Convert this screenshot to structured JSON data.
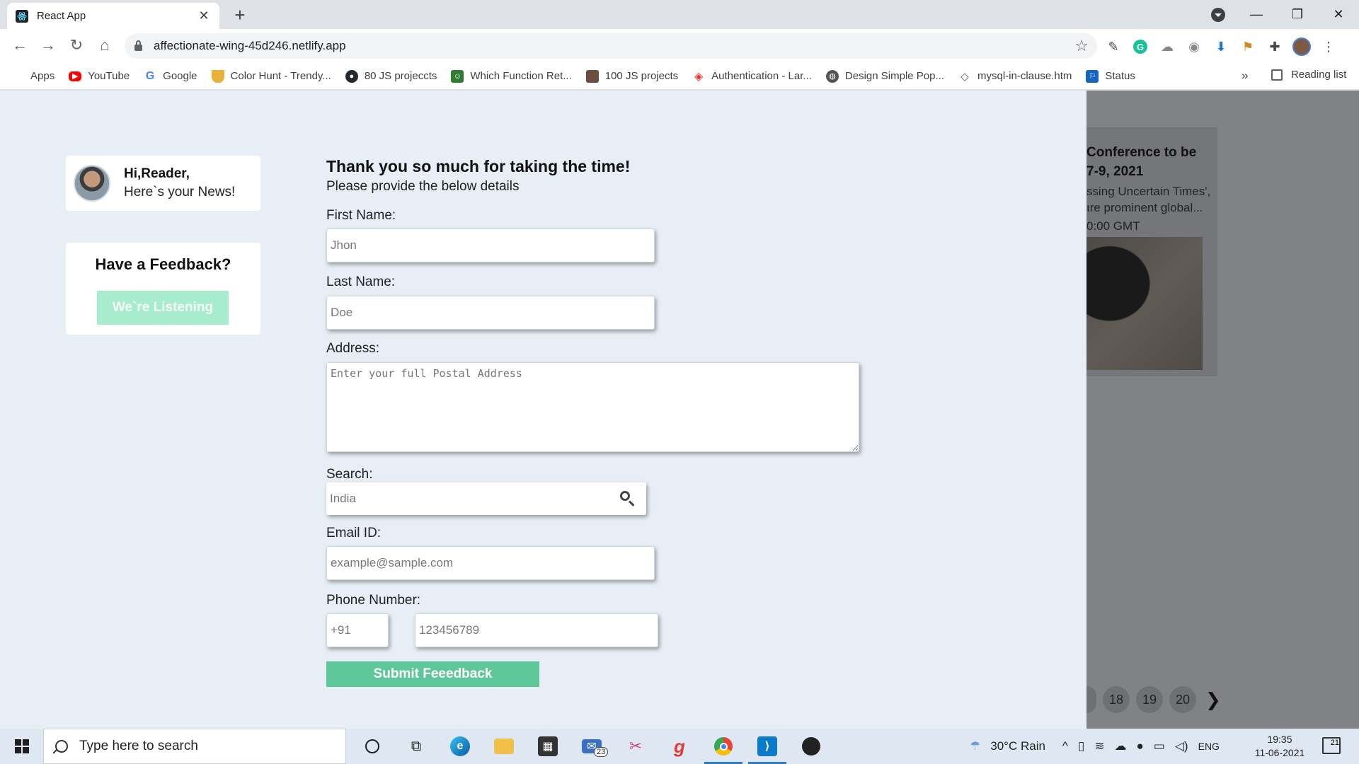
{
  "browser": {
    "tab_title": "React App",
    "url": "affectionate-wing-45d246.netlify.app",
    "bookmarks": [
      {
        "label": "Apps",
        "icon": "apps-grid-icon",
        "color": "#4285f4"
      },
      {
        "label": "YouTube",
        "icon": "youtube-icon",
        "color": "#ff0000"
      },
      {
        "label": "Google",
        "icon": "google-icon",
        "color": "#4285f4"
      },
      {
        "label": "Color Hunt - Trendy...",
        "icon": "color-hunt-icon",
        "color": "#e8b23a"
      },
      {
        "label": "80 JS projeccts",
        "icon": "github-icon",
        "color": "#24292e"
      },
      {
        "label": "Which Function Ret...",
        "icon": "bookmark-site-icon",
        "color": "#2e7d32"
      },
      {
        "label": "100 JS projects",
        "icon": "bookmark-avatar-icon",
        "color": "#6d4c41"
      },
      {
        "label": "Authentication - Lar...",
        "icon": "laravel-icon",
        "color": "#ff2d20"
      },
      {
        "label": "Design Simple Pop...",
        "icon": "globe-icon",
        "color": "#444444"
      },
      {
        "label": "mysql-in-clause.htm",
        "icon": "code-icon",
        "color": "#555555"
      },
      {
        "label": "Status",
        "icon": "status-icon",
        "color": "#1565c0"
      }
    ],
    "bookmarks_more": "»",
    "reading_list": "Reading list"
  },
  "sidebar": {
    "greeting_name": "Hi,Reader,",
    "greeting_sub": "Here`s your News!",
    "feedback_title": "Have a Feedback?",
    "feedback_button": "We`re Listening"
  },
  "form": {
    "title": "Thank you so much for taking the time!",
    "subtitle": "Please provide the below details",
    "first_name_label": "First Name:",
    "first_name_placeholder": "Jhon",
    "last_name_label": "Last Name:",
    "last_name_placeholder": "Doe",
    "address_label": "Address:",
    "address_placeholder": "Enter your full Postal Address",
    "search_label": "Search:",
    "search_placeholder": "India",
    "email_label": "Email ID:",
    "email_placeholder": "example@sample.com",
    "phone_label": "Phone Number:",
    "phone_code_placeholder": "+91",
    "phone_placeholder": "123456789",
    "submit": "Submit Feeedback"
  },
  "news_panel": {
    "title_line1": "Conference to be",
    "title_line2": "7-9, 2021",
    "body_line1": "ssing Uncertain Times',",
    "body_line2": "ıre prominent global...",
    "time": "0:00 GMT",
    "pages": [
      "18",
      "19",
      "20"
    ],
    "next": "❯"
  },
  "taskbar": {
    "search_placeholder": "Type here to search",
    "mail_badge": "23",
    "weather": "30°C  Rain",
    "language": "ENG",
    "time": "19:35",
    "date": "11-06-2021",
    "notifications": "21"
  }
}
